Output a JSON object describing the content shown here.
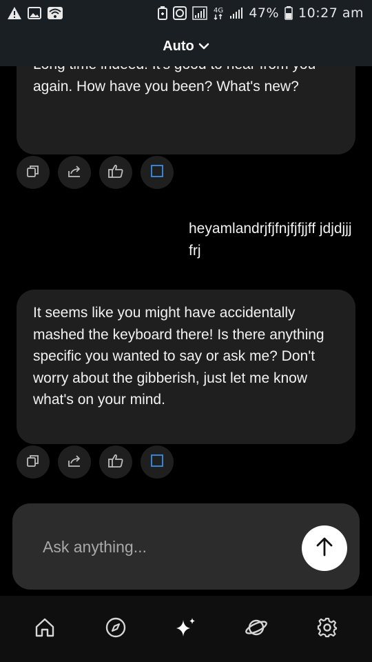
{
  "status_bar": {
    "left_icons": [
      "warning-icon",
      "image-icon",
      "wifi-icon"
    ],
    "right_icons": [
      "battery-saver-icon",
      "data-saver-icon",
      "signal-icon",
      "4g-icon",
      "signal-2-icon",
      "battery-icon"
    ],
    "network": "4G",
    "battery": "47%",
    "time": "10:27 am"
  },
  "header": {
    "model_label": "Auto",
    "dropdown_icon": "chevron-down-icon"
  },
  "messages": [
    {
      "role": "assistant",
      "text": "Long time indeed! It's good to hear from you again. How have you been? What's new?"
    },
    {
      "role": "user",
      "text": "heyamlandrjfjfnjfjfjjff jdjdjjjfrj"
    },
    {
      "role": "assistant",
      "text": "It seems like you might have accidentally mashed the keyboard there! Is there anything specific you wanted to say or ask me? Don't worry about the gibberish, just let me know what's on your mind."
    }
  ],
  "message_actions": [
    "copy-icon",
    "share-icon",
    "thumbs-up-icon",
    "stop-icon"
  ],
  "input": {
    "placeholder": "Ask anything...",
    "value": "",
    "send_icon": "arrow-up-icon"
  },
  "bottom_nav": [
    "home-icon",
    "compass-icon",
    "sparkle-icon",
    "planet-icon",
    "gear-icon"
  ],
  "colors": {
    "status_bar_bg": "#1a1f24",
    "bubble_bg": "#1f1f1f",
    "input_bg": "#2c2c2c",
    "stop_accent": "#3b8fe8",
    "send_bg": "#ffffff"
  }
}
